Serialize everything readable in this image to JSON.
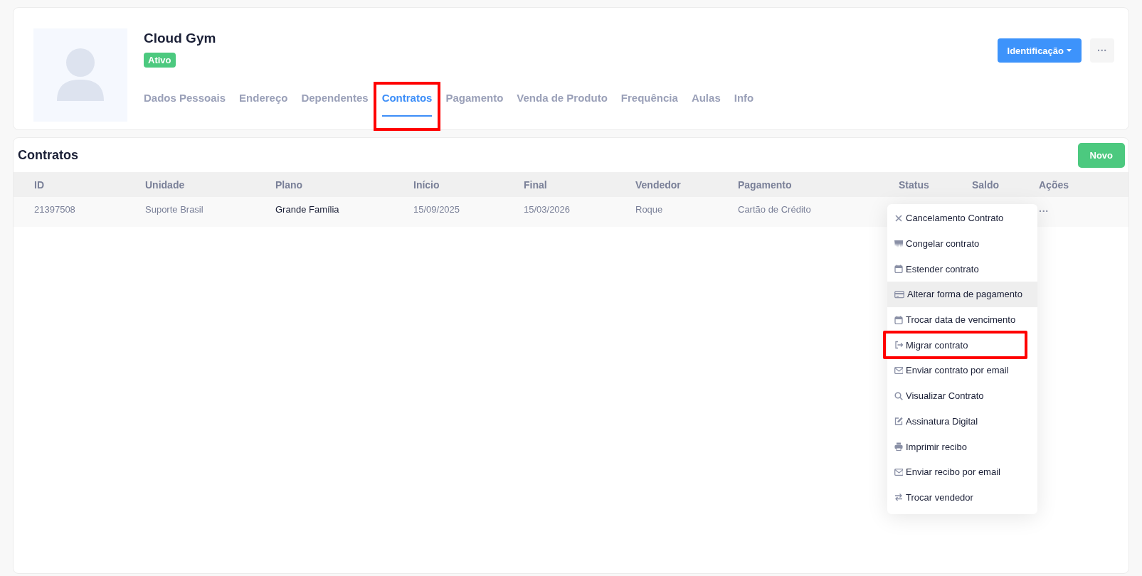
{
  "profile": {
    "name": "Cloud Gym",
    "status_badge": "Ativo",
    "primary_button": "Identificação",
    "more_button": "···"
  },
  "tabs": [
    {
      "label": "Dados Pessoais",
      "selected": false,
      "highlighted": false
    },
    {
      "label": "Endereço",
      "selected": false,
      "highlighted": false
    },
    {
      "label": "Dependentes",
      "selected": false,
      "highlighted": false
    },
    {
      "label": "Contratos",
      "selected": true,
      "highlighted": true
    },
    {
      "label": "Pagamento",
      "selected": false,
      "highlighted": false
    },
    {
      "label": "Venda de Produto",
      "selected": false,
      "highlighted": false
    },
    {
      "label": "Frequência",
      "selected": false,
      "highlighted": false
    },
    {
      "label": "Aulas",
      "selected": false,
      "highlighted": false
    },
    {
      "label": "Info",
      "selected": false,
      "highlighted": false
    }
  ],
  "contracts": {
    "title": "Contratos",
    "new_button": "Novo",
    "columns": [
      "ID",
      "Unidade",
      "Plano",
      "Início",
      "Final",
      "Vendedor",
      "Pagamento",
      "Status",
      "Saldo",
      "Ações"
    ],
    "rows": [
      {
        "cells": [
          "21397508",
          "Suporte Brasil",
          "Grande Família",
          "15/09/2025",
          "15/03/2026",
          "Roque",
          "Cartão de Crédito",
          "",
          ""
        ],
        "actions": "···"
      }
    ]
  },
  "action_menu": [
    {
      "kind": "close",
      "label": "Cancelamento Contrato",
      "hovered": false,
      "highlighted": false
    },
    {
      "kind": "freeze",
      "label": "Congelar contrato",
      "hovered": false,
      "highlighted": false
    },
    {
      "kind": "calendar",
      "label": "Estender contrato",
      "hovered": false,
      "highlighted": false
    },
    {
      "kind": "card",
      "label": "Alterar forma de pagamento",
      "hovered": true,
      "highlighted": false
    },
    {
      "kind": "calendar",
      "label": "Trocar data de vencimento",
      "hovered": false,
      "highlighted": false
    },
    {
      "kind": "exit",
      "label": "Migrar contrato",
      "hovered": false,
      "highlighted": true
    },
    {
      "kind": "mail",
      "label": "Enviar contrato por email",
      "hovered": false,
      "highlighted": false
    },
    {
      "kind": "search",
      "label": "Visualizar Contrato",
      "hovered": false,
      "highlighted": false
    },
    {
      "kind": "edit",
      "label": "Assinatura Digital",
      "hovered": false,
      "highlighted": false
    },
    {
      "kind": "print",
      "label": "Imprimir recibo",
      "hovered": false,
      "highlighted": false
    },
    {
      "kind": "mail",
      "label": "Enviar recibo por email",
      "hovered": false,
      "highlighted": false
    },
    {
      "kind": "swap",
      "label": "Trocar vendedor",
      "hovered": false,
      "highlighted": false
    }
  ]
}
